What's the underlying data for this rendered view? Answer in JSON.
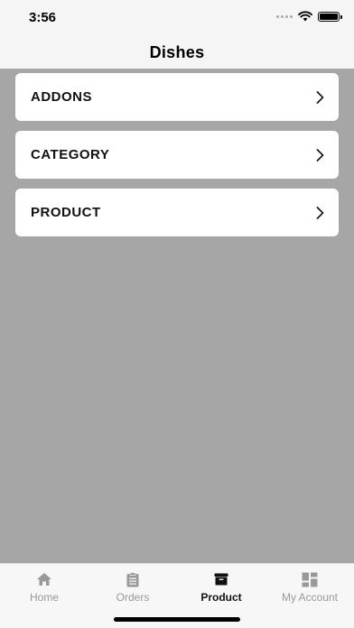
{
  "status_bar": {
    "time": "3:56"
  },
  "header": {
    "title": "Dishes"
  },
  "menu": {
    "items": [
      {
        "label": "ADDONS"
      },
      {
        "label": "CATEGORY"
      },
      {
        "label": "PRODUCT"
      }
    ]
  },
  "tabbar": {
    "tabs": [
      {
        "label": "Home",
        "icon": "home-icon",
        "active": false
      },
      {
        "label": "Orders",
        "icon": "clipboard-icon",
        "active": false
      },
      {
        "label": "Product",
        "icon": "archive-box-icon",
        "active": true
      },
      {
        "label": "My Account",
        "icon": "dashboard-grid-icon",
        "active": false
      }
    ]
  },
  "colors": {
    "overlay": "#a6a6a6",
    "active_tab": "#111111",
    "inactive_tab": "#999999"
  }
}
